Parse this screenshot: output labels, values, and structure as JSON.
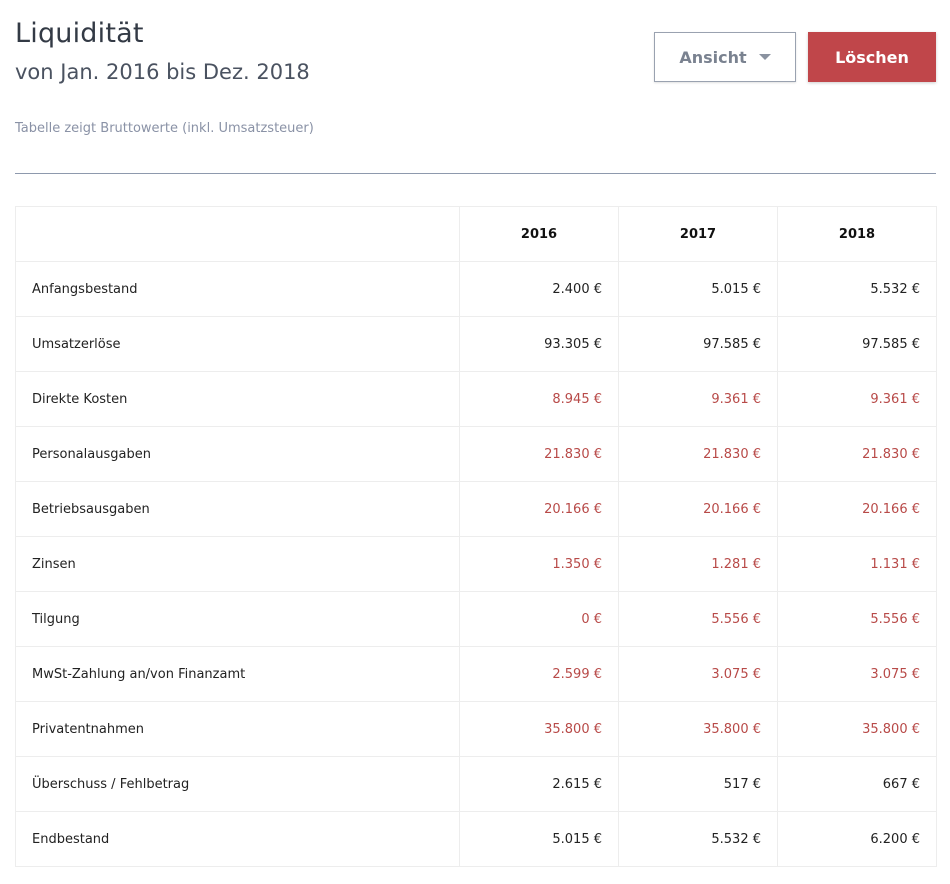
{
  "header": {
    "title": "Liquidität",
    "subtitle": "von Jan. 2016 bis Dez. 2018",
    "note": "Tabelle zeigt Bruttowerte (inkl. Umsatzsteuer)"
  },
  "actions": {
    "view_label": "Ansicht",
    "delete_label": "Löschen"
  },
  "colors": {
    "accent_red": "#c0464a",
    "negative_text": "#b84a48"
  },
  "table": {
    "columns": [
      "",
      "2016",
      "2017",
      "2018"
    ],
    "rows": [
      {
        "label": "Anfangsbestand",
        "values": [
          "2.400 €",
          "5.015 €",
          "5.532 €"
        ],
        "negative": false
      },
      {
        "label": "Umsatzerlöse",
        "values": [
          "93.305 €",
          "97.585 €",
          "97.585 €"
        ],
        "negative": false
      },
      {
        "label": "Direkte Kosten",
        "values": [
          "8.945 €",
          "9.361 €",
          "9.361 €"
        ],
        "negative": true
      },
      {
        "label": "Personalausgaben",
        "values": [
          "21.830 €",
          "21.830 €",
          "21.830 €"
        ],
        "negative": true
      },
      {
        "label": "Betriebsausgaben",
        "values": [
          "20.166 €",
          "20.166 €",
          "20.166 €"
        ],
        "negative": true
      },
      {
        "label": "Zinsen",
        "values": [
          "1.350 €",
          "1.281 €",
          "1.131 €"
        ],
        "negative": true
      },
      {
        "label": "Tilgung",
        "values": [
          "0 €",
          "5.556 €",
          "5.556 €"
        ],
        "negative": true
      },
      {
        "label": "MwSt-Zahlung an/von Finanzamt",
        "values": [
          "2.599 €",
          "3.075 €",
          "3.075 €"
        ],
        "negative": true
      },
      {
        "label": "Privatentnahmen",
        "values": [
          "35.800 €",
          "35.800 €",
          "35.800 €"
        ],
        "negative": true
      },
      {
        "label": "Überschuss / Fehlbetrag",
        "values": [
          "2.615 €",
          "517 €",
          "667 €"
        ],
        "negative": false
      },
      {
        "label": "Endbestand",
        "values": [
          "5.015 €",
          "5.532 €",
          "6.200 €"
        ],
        "negative": false
      }
    ]
  }
}
